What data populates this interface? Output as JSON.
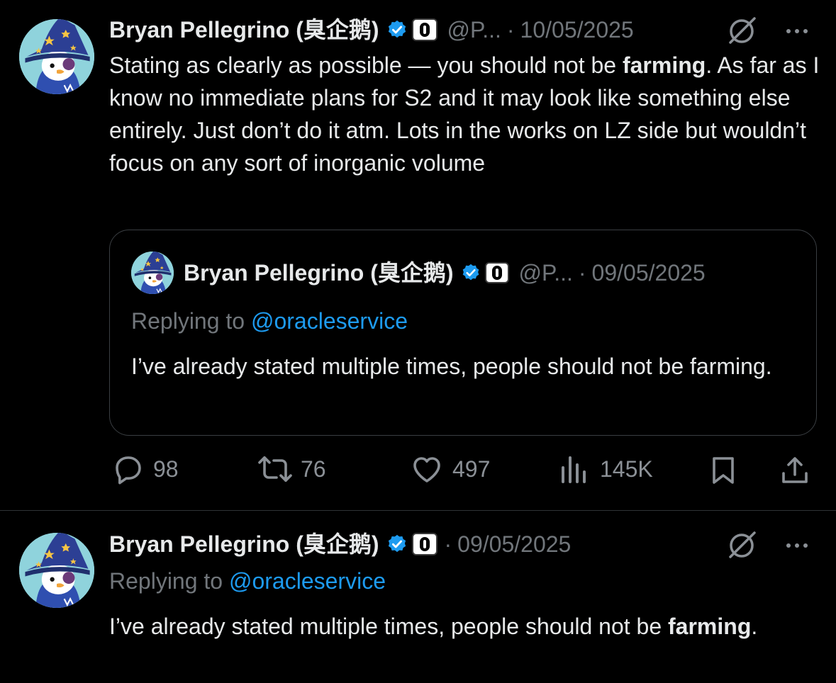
{
  "tweets": [
    {
      "author": {
        "name": "Bryan Pellegrino (臭企鹅)",
        "handle": "@P...",
        "verified_icon": "verified-badge-icon",
        "affiliation_icon": "layerzero-icon"
      },
      "separator": "·",
      "date": "10/05/2025",
      "text": {
        "line1_pre": "Stating as clearly as possible — you should not be ",
        "line1_bold": "farming",
        "line1_post": ".",
        "rest": "As far as I know no immediate plans for S2 and it may look like something else entirely. Just don’t do it atm. Lots in the works on LZ side but wouldn’t focus on any sort of inorganic volume"
      },
      "quote": {
        "author": {
          "name": "Bryan Pellegrino (臭企鹅)",
          "handle": "@P..."
        },
        "separator": "·",
        "date": "09/05/2025",
        "replying_label": "Replying to ",
        "replying_mention": "@oracleservice",
        "text": "I’ve already stated multiple times, people should not be farming."
      },
      "actions": {
        "replies": "98",
        "retweets": "76",
        "likes": "497",
        "views": "145K"
      }
    },
    {
      "author": {
        "name": "Bryan Pellegrino (臭企鹅)"
      },
      "separator": "·",
      "date": "09/05/2025",
      "replying_label": "Replying to ",
      "replying_mention": "@oracleservice",
      "text_pre": "I’ve already stated multiple times, people should not be ",
      "text_bold": "farming",
      "text_post": "."
    }
  ],
  "colors": {
    "background": "#000000",
    "text": "#e7e9ea",
    "secondary": "#71767b",
    "link": "#1d9bf0",
    "verified": "#1d9bf0",
    "border": "#2f3336"
  },
  "icons": [
    "grok-icon",
    "more-icon",
    "reply-icon",
    "retweet-icon",
    "like-icon",
    "views-icon",
    "bookmark-icon",
    "share-icon"
  ]
}
